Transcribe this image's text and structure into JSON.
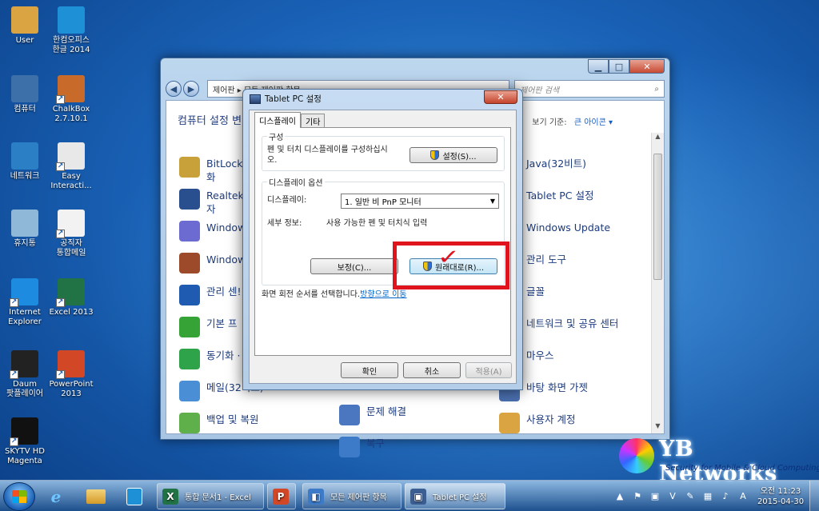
{
  "desktop": {
    "icons": [
      {
        "label": "User",
        "icon": "folder-icon",
        "color": "#d9a441"
      },
      {
        "label": "한컴오피스\n한글 2014",
        "icon": "hancom-icon",
        "color": "#1e90d6"
      },
      {
        "label": "컴퓨터",
        "icon": "computer-icon",
        "color": "#3d6fa8"
      },
      {
        "label": "ChalkBox\n2.7.10.1",
        "icon": "chalkbox-icon",
        "color": "#c86a2a"
      },
      {
        "label": "네트워크",
        "icon": "network-icon",
        "color": "#2b7fc4"
      },
      {
        "label": "Easy\nInteracti...",
        "icon": "easy-interactive-icon",
        "color": "#e8e8e8"
      },
      {
        "label": "휴지통",
        "icon": "recycle-bin-icon",
        "color": "#8fb8d8"
      },
      {
        "label": "공직자\n통합메일",
        "icon": "mail-icon",
        "color": "#f2f2f2"
      },
      {
        "label": "Internet\nExplorer",
        "icon": "ie-icon",
        "color": "#1c8be0"
      },
      {
        "label": "Excel 2013",
        "icon": "excel-icon",
        "color": "#217346"
      },
      {
        "label": "Daum\n팟플레이어",
        "icon": "potplayer-icon",
        "color": "#222222"
      },
      {
        "label": "PowerPoint\n2013",
        "icon": "powerpoint-icon",
        "color": "#d24726"
      },
      {
        "label": "SKYTV HD\nMagenta",
        "icon": "skytv-icon",
        "color": "#111111"
      }
    ]
  },
  "control_panel": {
    "address_sep": "▸",
    "address_path": "제어판 ▸ 모든 제어판 항목 ▸",
    "search_placeholder": "제어판 검색",
    "heading": "컴퓨터 설정 변",
    "view_by_label": "보기 기준:",
    "view_by_value": "큰 아이콘 ▾",
    "col1": [
      {
        "label": "BitLocke\n화",
        "color": "#c8a13a"
      },
      {
        "label": "Realtek\n자",
        "color": "#2a4f8e"
      },
      {
        "label": "Window",
        "color": "#6b6bd1"
      },
      {
        "label": "Window",
        "color": "#9c4a2a"
      },
      {
        "label": "관리 센!",
        "color": "#1f5bb0"
      },
      {
        "label": "기본 프",
        "color": "#36a336"
      },
      {
        "label": "동기화 ·",
        "color": "#2fa34a"
      },
      {
        "label": "메일(32비트)",
        "color": "#4a8fd6"
      },
      {
        "label": "백업 및 복원",
        "color": "#5fb04a"
      }
    ],
    "col2": [
      {
        "label": "문제 해결",
        "color": "#4a77c0"
      },
      {
        "label": "복구",
        "color": "#3d7bc9"
      }
    ],
    "col3": [
      {
        "label": "Java(32비트)",
        "color": "#e04a2a"
      },
      {
        "label": "Tablet PC 설정",
        "color": "#3c5f93"
      },
      {
        "label": "Windows Update",
        "color": "#2b7fd4"
      },
      {
        "label": "관리 도구",
        "color": "#8a8a8a"
      },
      {
        "label": "글꼴",
        "color": "#d4a12a"
      },
      {
        "label": "네트워크 및 공유 센터",
        "color": "#3a86d6"
      },
      {
        "label": "마우스",
        "color": "#7b7b7b"
      },
      {
        "label": "바탕 화면 가젯",
        "color": "#4a6fb0"
      },
      {
        "label": "사용자 계정",
        "color": "#d9a441"
      }
    ]
  },
  "dialog": {
    "title": "Tablet PC 설정",
    "close_label": "✕",
    "tabs": [
      "디스플레이",
      "기타"
    ],
    "group_config_title": "구성",
    "group_config_text": "펜 및 터치 디스플레이를 구성하십시\n오.",
    "setup_button": "설정(S)...",
    "group_display_title": "디스플레이 옵션",
    "display_label": "디스플레이:",
    "display_value": "1. 일반 비 PnP 모니터",
    "detail_label": "세부 정보:",
    "detail_value": "사용 가능한 펜 및 터치식 입력",
    "calibrate_button": "보정(C)...",
    "reset_button": "원래대로(R)...",
    "rotation_text": "화면 회전 순서를 선택합니다.",
    "rotation_link": "방향으로 이동",
    "ok_button": "확인",
    "cancel_button": "취소",
    "apply_button": "적용(A)"
  },
  "logo": {
    "name": "YB Networks",
    "tagline": "Security for Mobile & Cloud Computing"
  },
  "taskbar": {
    "tasks": [
      {
        "label": "통합 문서1 - Excel",
        "icon": "excel-icon",
        "color": "#217346",
        "glyph": "X"
      },
      {
        "label": "",
        "icon": "powerpoint-icon",
        "color": "#d24726",
        "glyph": "P"
      },
      {
        "label": "모든 제어판 항목",
        "icon": "control-panel-icon",
        "color": "#3d7bc9",
        "glyph": "◧"
      },
      {
        "label": "Tablet PC 설정",
        "icon": "tablet-pc-icon",
        "color": "#3c5f93",
        "glyph": "▣"
      }
    ],
    "clock_time": "오전 11:23",
    "clock_date": "2015-04-30"
  }
}
